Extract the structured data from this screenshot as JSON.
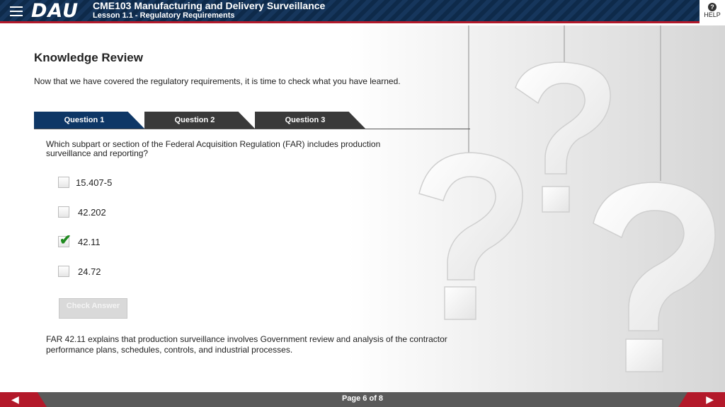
{
  "header": {
    "menu_icon": "hamburger-menu-icon",
    "logo": "DAU",
    "course_title": "CME103 Manufacturing and Delivery Surveillance",
    "lesson_title": "Lesson 1.1 - Regulatory Requirements",
    "help_icon": "question-circle-icon",
    "help_label": "HELP"
  },
  "colors": {
    "header_navy": "#0e2a4a",
    "accent_red": "#b3192a",
    "tab_active": "#0e3766",
    "tab_inactive": "#3a3a3a",
    "check_green": "#1f8a1f"
  },
  "content": {
    "title": "Knowledge Review",
    "intro": "Now that we have covered the regulatory requirements, it is time to check what you have learned.",
    "tabs": [
      {
        "label": "Question 1",
        "active": true
      },
      {
        "label": "Question 2",
        "active": false
      },
      {
        "label": "Question 3",
        "active": false
      }
    ],
    "question": "Which subpart or section of the Federal Acquisition Regulation (FAR) includes production surveillance and reporting?",
    "options": [
      {
        "label": "15.407-5",
        "checked": false
      },
      {
        "label": "42.202",
        "checked": false
      },
      {
        "label": "42.11",
        "checked": true
      },
      {
        "label": "24.72",
        "checked": false
      }
    ],
    "check_answer_label": "Check Answer",
    "feedback": "FAR 42.11 explains that production surveillance involves Government review and analysis of the contractor performance plans, schedules, controls, and industrial processes."
  },
  "footer": {
    "page_indicator": "Page 6 of 8",
    "prev_icon": "arrow-left-icon",
    "next_icon": "arrow-right-icon"
  }
}
